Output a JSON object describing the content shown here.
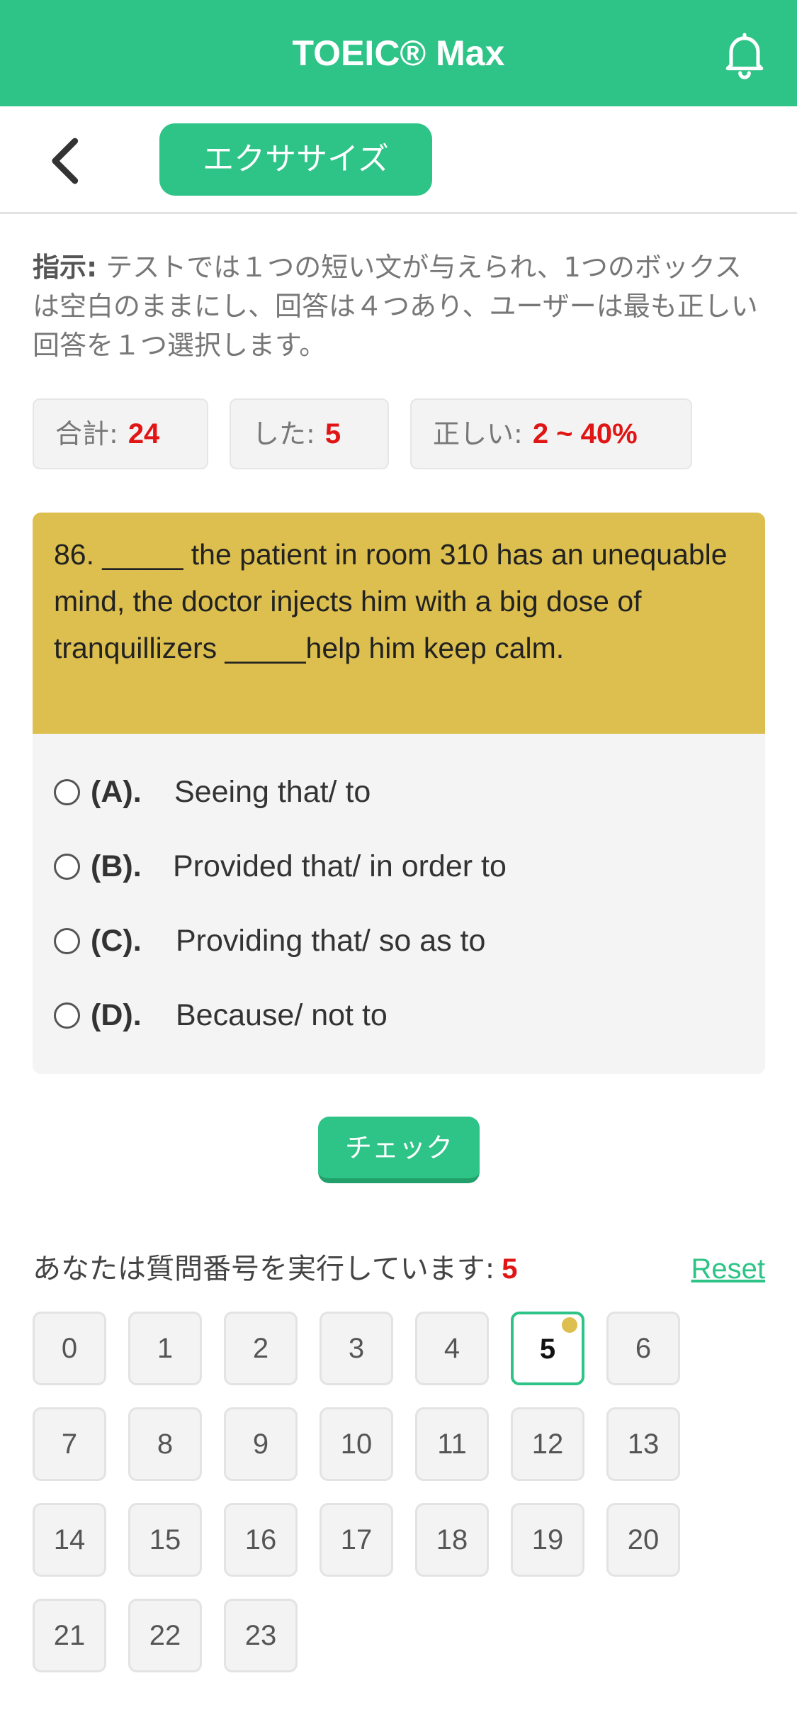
{
  "appbar": {
    "title": "TOEIC® Max"
  },
  "subbar": {
    "exercise_label": "エクササイズ"
  },
  "instructions": {
    "label": "指示:",
    "text": " テストでは１つの短い文が与えられ、1つのボックスは空白のままにし、回答は４つあり、ユーザーは最も正しい回答を１つ選択します。"
  },
  "stats": {
    "total_label": "合計:",
    "total_value": "24",
    "done_label": "した:",
    "done_value": "5",
    "correct_label": "正しい:",
    "correct_value": "2 ~ 40%"
  },
  "question": {
    "text": "86. _____ the patient in room 310 has an unequable mind, the doctor injects him with a big dose of tranquillizers _____help him keep calm."
  },
  "options": [
    {
      "letter": "(A).",
      "text": "Seeing that/ to"
    },
    {
      "letter": "(B).",
      "text": "Provided that/ in order to"
    },
    {
      "letter": "(C).",
      "text": "Providing that/ so as to"
    },
    {
      "letter": "(D).",
      "text": "Because/ not to"
    }
  ],
  "check_label": "チェック",
  "progress": {
    "label": "あなたは質問番号を実行しています:",
    "current": "5",
    "reset": "Reset"
  },
  "question_numbers": [
    "0",
    "1",
    "2",
    "3",
    "4",
    "5",
    "6",
    "7",
    "8",
    "9",
    "10",
    "11",
    "12",
    "13",
    "14",
    "15",
    "16",
    "17",
    "18",
    "19",
    "20",
    "21",
    "22",
    "23"
  ],
  "active_question": 5,
  "colors": {
    "primary": "#2ec387",
    "question_bg": "#dcbf4e",
    "highlight": "#e01515"
  }
}
